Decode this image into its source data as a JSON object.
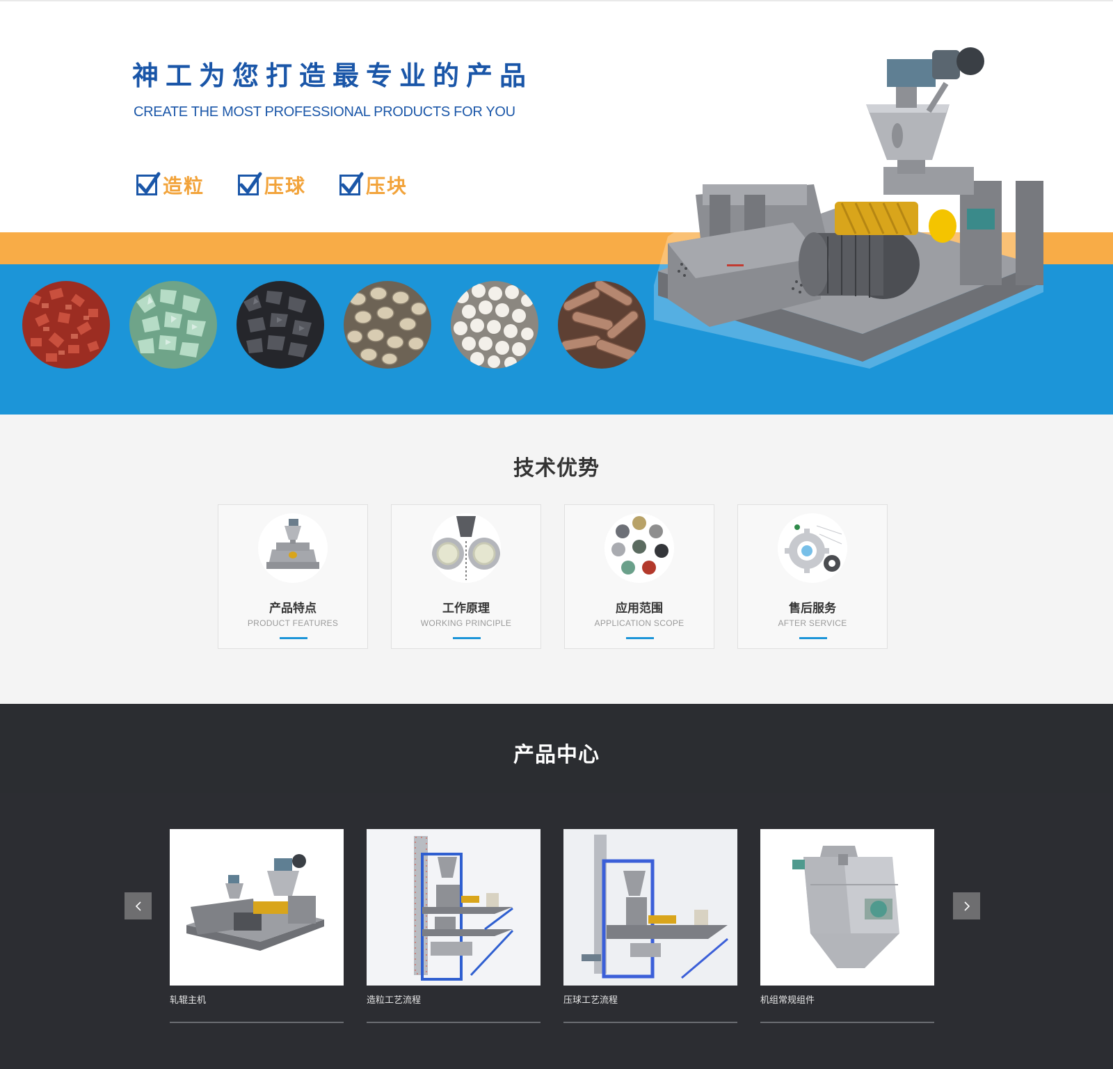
{
  "hero": {
    "title": "神工为您打造最专业的产品",
    "subtitle": "CREATE THE MOST PROFESSIONAL PRODUCTS FOR YOU",
    "checks": [
      "造粒",
      "压球",
      "压块"
    ],
    "materials": [
      {
        "icon": "red-granules-icon",
        "color": "#b3392b"
      },
      {
        "icon": "green-granules-icon",
        "color": "#8fc0a4"
      },
      {
        "icon": "black-granules-icon",
        "color": "#3e3f45"
      },
      {
        "icon": "beige-pellets-icon",
        "color": "#c7b89b"
      },
      {
        "icon": "white-balls-icon",
        "color": "#dedad2"
      },
      {
        "icon": "brown-briquettes-icon",
        "color": "#8a5b45"
      }
    ],
    "colors": {
      "blue": "#1c95d8",
      "orange": "#f8ac47",
      "title": "#1a56a8"
    }
  },
  "advantages": {
    "title": "技术优势",
    "cards": [
      {
        "title": "产品特点",
        "subtitle": "PRODUCT FEATURES",
        "icon": "machine-icon"
      },
      {
        "title": "工作原理",
        "subtitle": "WORKING PRINCIPLE",
        "icon": "rollers-icon"
      },
      {
        "title": "应用范围",
        "subtitle": "APPLICATION SCOPE",
        "icon": "materials-icon"
      },
      {
        "title": "售后服务",
        "subtitle": "AFTER SERVICE",
        "icon": "gears-icon"
      }
    ]
  },
  "products": {
    "title": "产品中心",
    "items": [
      {
        "name": "轧辊主机",
        "icon": "roller-machine-image"
      },
      {
        "name": "造粒工艺流程",
        "icon": "granulation-process-image"
      },
      {
        "name": "压球工艺流程",
        "icon": "briquetting-process-image"
      },
      {
        "name": "机组常规组件",
        "icon": "unit-components-image"
      }
    ],
    "prev_icon": "chevron-left-icon",
    "next_icon": "chevron-right-icon"
  }
}
